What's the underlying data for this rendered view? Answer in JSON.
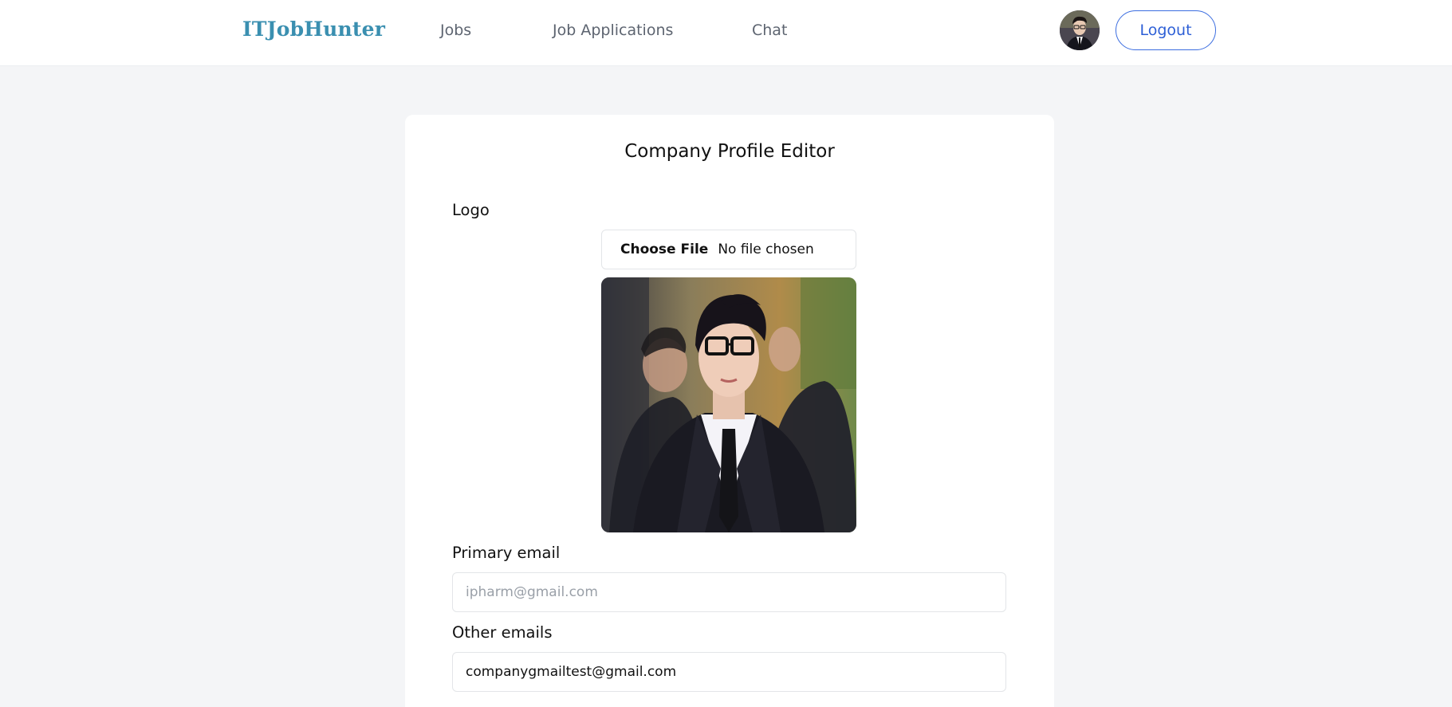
{
  "nav": {
    "brand": "ITJobHunter",
    "links": [
      "Jobs",
      "Job Applications",
      "Chat"
    ],
    "logout_label": "Logout",
    "brand_color": "#3a8fb0",
    "accent_color": "#2d5fd6"
  },
  "editor": {
    "title": "Company Profile Editor",
    "logo_label": "Logo",
    "file_button_label": "Choose File",
    "file_status": "No file chosen",
    "primary_email_label": "Primary email",
    "primary_email_placeholder": "ipharm@gmail.com",
    "other_emails_label": "Other emails",
    "other_emails_value": "companygmailtest@gmail.com"
  },
  "icons": [
    "user-avatar",
    "logo-photo"
  ]
}
